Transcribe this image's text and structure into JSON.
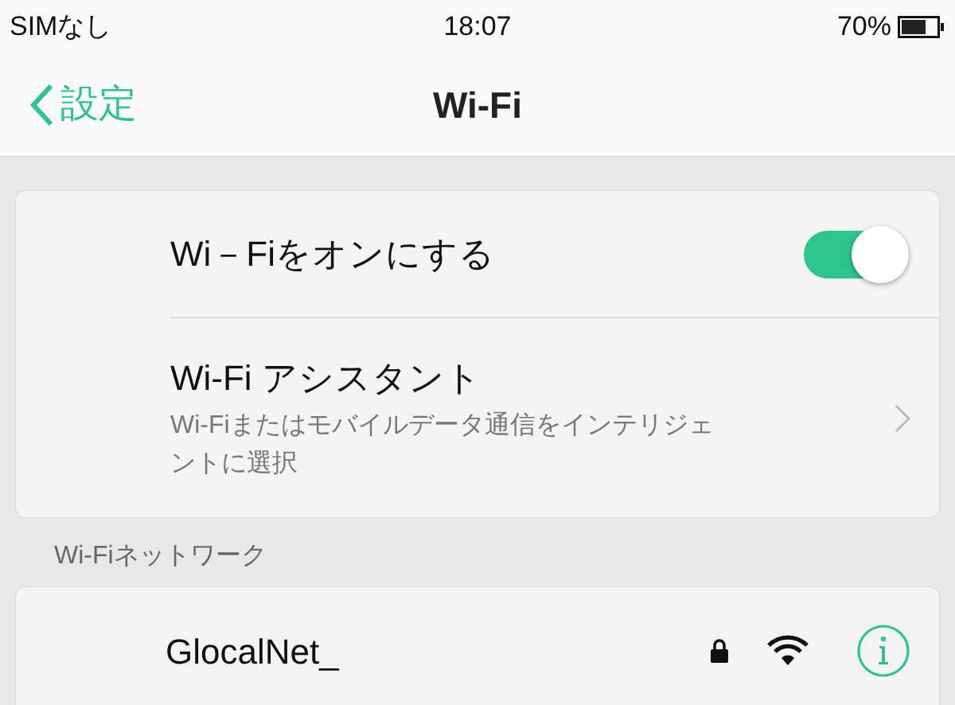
{
  "status_bar": {
    "carrier": "SIMなし",
    "time": "18:07",
    "battery": "70%"
  },
  "nav": {
    "back": "設定",
    "title": "Wi-Fi"
  },
  "settings": [
    {
      "kind": "toggle",
      "label": "Wi－Fiをオンにする",
      "on": true
    },
    {
      "kind": "link",
      "label": "Wi-Fi アシスタント",
      "description": "Wi-Fiまたはモバイルデータ通信をインテリジェントに選択"
    }
  ],
  "networks_header": "Wi-Fiネットワーク",
  "networks": [
    {
      "name": "GlocalNet_",
      "locked": true
    }
  ]
}
